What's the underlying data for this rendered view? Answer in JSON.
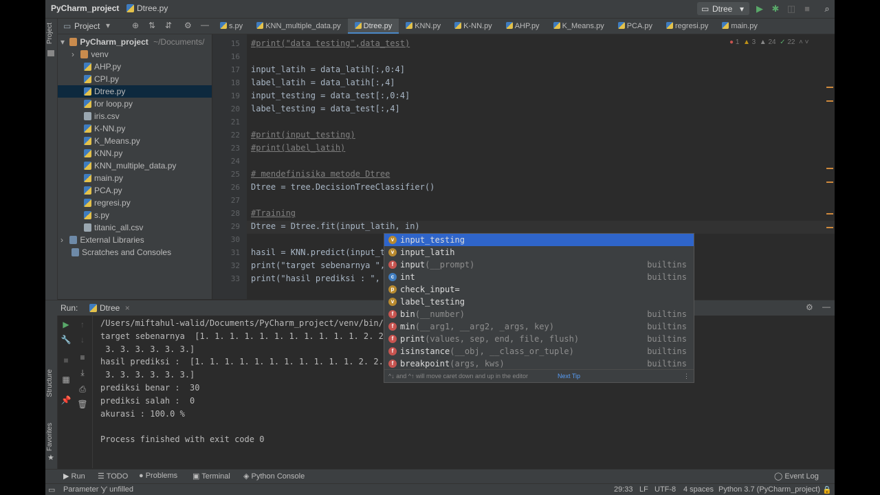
{
  "title_bar": {
    "project": "PyCharm_project",
    "file": "Dtree.py",
    "run_config": "Dtree"
  },
  "project_panel": {
    "header_label": "Project",
    "root": "PyCharm_project",
    "root_path": "~/Documents/",
    "items": [
      "venv",
      "AHP.py",
      "CPI.py",
      "Dtree.py",
      "for loop.py",
      "iris.csv",
      "K-NN.py",
      "K_Means.py",
      "KNN.py",
      "KNN_multiple_data.py",
      "main.py",
      "PCA.py",
      "regresi.py",
      "s.py",
      "titanic_all.csv"
    ],
    "external_libraries": "External Libraries",
    "scratches": "Scratches and Consoles"
  },
  "tabs": [
    "s.py",
    "KNN_multiple_data.py",
    "Dtree.py",
    "KNN.py",
    "K-NN.py",
    "AHP.py",
    "K_Means.py",
    "PCA.py",
    "regresi.py",
    "main.py"
  ],
  "inspection": {
    "errors": "1",
    "warnings": "3",
    "weak": "24",
    "typos": "22"
  },
  "editor": {
    "lines": [
      {
        "n": "15",
        "text": "#print(\"data testing\",data_test)"
      },
      {
        "n": "16",
        "text": ""
      },
      {
        "n": "17",
        "text": "input_latih = data_latih[:,0:4]"
      },
      {
        "n": "18",
        "text": "label_latih = data_latih[:,4]"
      },
      {
        "n": "19",
        "text": "input_testing = data_test[:,0:4]"
      },
      {
        "n": "20",
        "text": "label_testing = data_test[:,4]"
      },
      {
        "n": "21",
        "text": ""
      },
      {
        "n": "22",
        "text": "#print(input_testing)"
      },
      {
        "n": "23",
        "text": "#print(label_latih)"
      },
      {
        "n": "24",
        "text": ""
      },
      {
        "n": "25",
        "text": "# mendefinisika metode Dtree"
      },
      {
        "n": "26",
        "text": "Dtree = tree.DecisionTreeClassifier()"
      },
      {
        "n": "27",
        "text": ""
      },
      {
        "n": "28",
        "text": "#Training"
      },
      {
        "n": "29",
        "text": "Dtree = Dtree.fit(input_latih, in)"
      },
      {
        "n": "30",
        "text": ""
      },
      {
        "n": "31",
        "text": "hasil = KNN.predict(input_t"
      },
      {
        "n": "32",
        "text": "print(\"target sebenarnya \","
      },
      {
        "n": "33",
        "text": "print(\"hasil prediksi : \","
      }
    ]
  },
  "completion": {
    "items": [
      {
        "badge": "v",
        "name": "input_testing",
        "sig": "",
        "src": ""
      },
      {
        "badge": "v",
        "name": "input_latih",
        "sig": "",
        "src": ""
      },
      {
        "badge": "f",
        "name": "input",
        "sig": "(__prompt)",
        "src": "builtins"
      },
      {
        "badge": "c",
        "name": "int",
        "sig": "",
        "src": "builtins"
      },
      {
        "badge": "p",
        "name": "check_input=",
        "sig": "",
        "src": ""
      },
      {
        "badge": "v",
        "name": "label_testing",
        "sig": "",
        "src": ""
      },
      {
        "badge": "f",
        "name": "bin",
        "sig": "(__number)",
        "src": "builtins"
      },
      {
        "badge": "f",
        "name": "min",
        "sig": "(__arg1, __arg2, _args, key)",
        "src": "builtins"
      },
      {
        "badge": "f",
        "name": "print",
        "sig": "(values, sep, end, file, flush)",
        "src": "builtins"
      },
      {
        "badge": "f",
        "name": "isinstance",
        "sig": "(__obj, __class_or_tuple)",
        "src": "builtins"
      },
      {
        "badge": "f",
        "name": "breakpoint",
        "sig": "(args, kws)",
        "src": "builtins"
      }
    ],
    "footer": "^↓ and ^↑ will move caret down and up in the editor",
    "next_tip": "Next Tip"
  },
  "run_panel": {
    "label": "Run:",
    "tab": "Dtree",
    "output": [
      "/Users/miftahul-walid/Documents/PyCharm_project/venv/bin/p",
      "target sebenarnya  [1. 1. 1. 1. 1. 1. 1. 1. 1. 1. 1. 2. 2. 2",
      " 3. 3. 3. 3. 3. 3.]",
      "hasil prediksi :  [1. 1. 1. 1. 1. 1. 1. 1. 1. 1. 1. 2. 2. 2.",
      " 3. 3. 3. 3. 3. 3.]",
      "prediksi benar :  30",
      "prediksi salah :  0",
      "akurasi : 100.0 %",
      "",
      "Process finished with exit code 0"
    ]
  },
  "bottom_tools": {
    "run": "Run",
    "todo": "TODO",
    "problems": "Problems",
    "terminal": "Terminal",
    "python_console": "Python Console",
    "event_log": "Event Log"
  },
  "left_strip": {
    "project": "Project",
    "structure": "Structure",
    "favorites": "Favorites"
  },
  "status_bar": {
    "message": "Parameter 'y' unfilled",
    "position": "29:33",
    "line_sep": "LF",
    "encoding": "UTF-8",
    "indent": "4 spaces",
    "interpreter": "Python 3.7 (PyCharm_project)"
  }
}
